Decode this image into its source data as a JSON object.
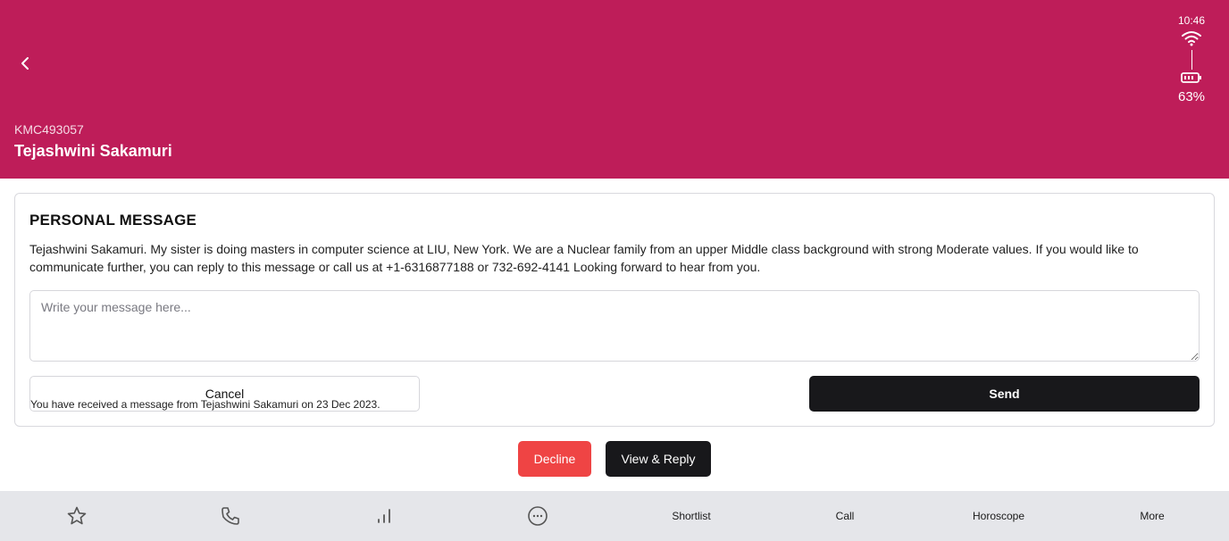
{
  "status_bar": {
    "time": "10:46",
    "battery": "63%"
  },
  "header": {
    "profile_id": "KMC493057",
    "profile_name": "Tejashwini Sakamuri",
    "background_color": "#be1d59"
  },
  "message_card": {
    "title": "PERSONAL MESSAGE",
    "body": "Tejashwini Sakamuri. My sister is doing masters in computer science at LIU, New York. We are a Nuclear family from an upper Middle class background with strong Moderate values. If you would like to communicate further, you can reply to this message or call us at +1-6316877188 or 732-692-4141 Looking forward to hear from you.",
    "input_placeholder": "Write your message here...",
    "input_value": "",
    "cancel_label": "Cancel",
    "send_label": "Send",
    "received_note": "You have received a message from Tejashwini Sakamuri on 23 Dec 2023."
  },
  "actions": {
    "decline_label": "Decline",
    "view_reply_label": "View & Reply",
    "decline_color": "#ef4444"
  },
  "bottom_bar": {
    "icons": [
      "star-icon",
      "phone-icon",
      "bar-chart-icon",
      "chat-dots-icon"
    ],
    "items": [
      "Shortlist",
      "Call",
      "Horoscope",
      "More"
    ]
  }
}
